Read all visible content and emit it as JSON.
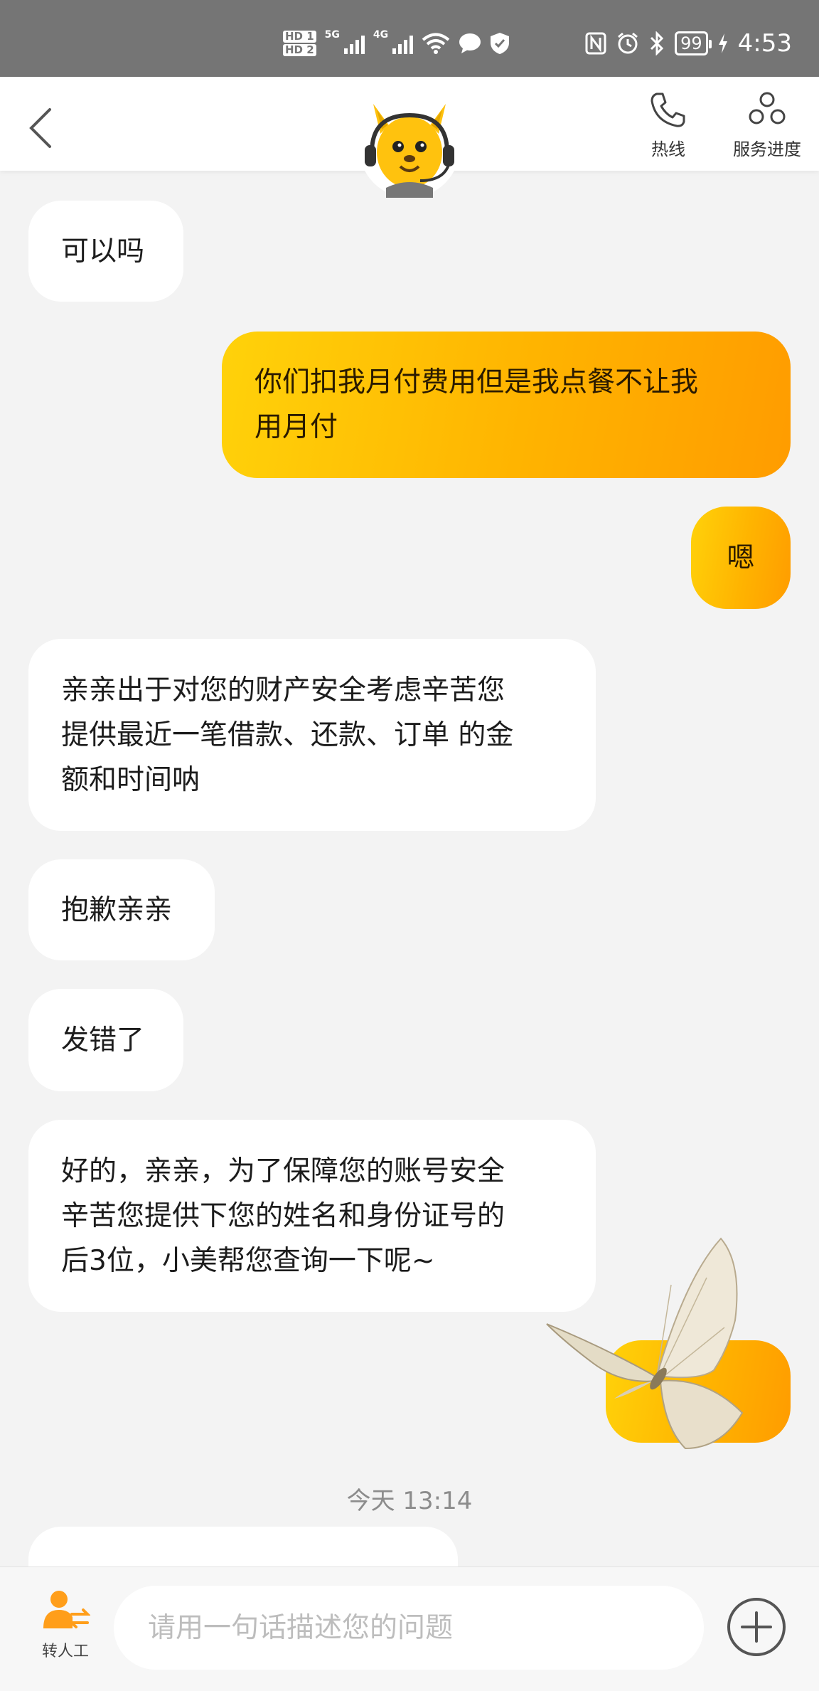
{
  "status_bar": {
    "hd_labels": [
      "HD 1",
      "HD 2"
    ],
    "network_1": "5G",
    "network_2": "4G",
    "battery": "99",
    "time": "4:53"
  },
  "header": {
    "hotline_label": "热线",
    "progress_label": "服务进度",
    "accent_color": "#FFC107"
  },
  "messages": [
    {
      "side": "in",
      "text": "可以吗"
    },
    {
      "side": "out",
      "text_lines": [
        "你们扣我月付费用但是我点餐不让我",
        "用月付"
      ]
    },
    {
      "side": "out",
      "text": "嗯"
    },
    {
      "side": "in",
      "text_lines": [
        "亲亲出于对您的财产安全考虑辛苦您",
        "提供最近一笔借款、还款、订单 的金",
        "额和时间呐"
      ]
    },
    {
      "side": "in",
      "text": "抱歉亲亲"
    },
    {
      "side": "in",
      "text": "发错了"
    },
    {
      "side": "in",
      "text_lines": [
        "好的，亲亲，为了保障您的账号安全",
        "辛苦您提供下您的姓名和身份证号的",
        "后3位，小美帮您查询一下呢~"
      ]
    },
    {
      "side": "out",
      "text": "",
      "sticker": "butterfly-sticker"
    }
  ],
  "timestamp": "今天 13:14",
  "bottom_bar": {
    "transfer_label": "转人工",
    "input_placeholder": "请用一句话描述您的问题"
  }
}
